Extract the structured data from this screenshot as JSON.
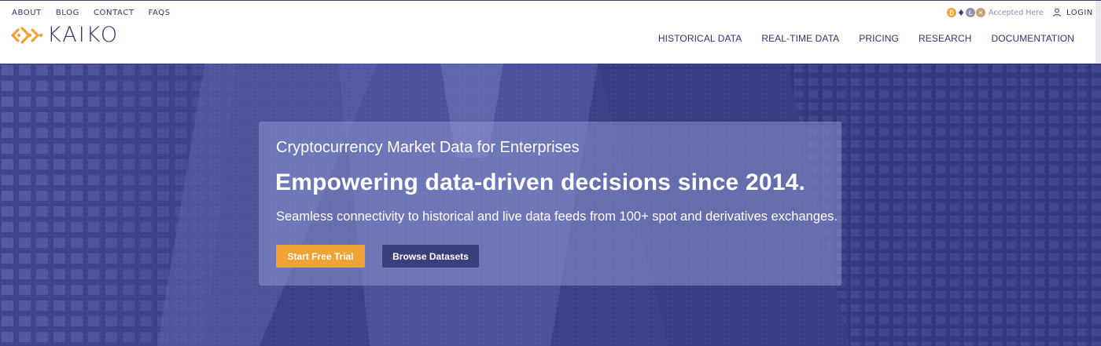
{
  "top_links": [
    "ABOUT",
    "BLOG",
    "CONTACT",
    "FAQS"
  ],
  "logo": {
    "text": "KAIKO"
  },
  "crypto": {
    "accepted_text": "Accepted Here",
    "coins": [
      "btc-icon",
      "eth-icon",
      "ltc-icon",
      "xrp-icon"
    ]
  },
  "login": {
    "label": "LOGIN"
  },
  "nav": [
    "HISTORICAL DATA",
    "REAL-TIME DATA",
    "PRICING",
    "RESEARCH",
    "DOCUMENTATION"
  ],
  "hero": {
    "kicker": "Cryptocurrency Market Data for Enterprises",
    "headline": "Empowering data-driven decisions since 2014.",
    "subtext": "Seamless connectivity to historical and live data feeds from 100+ spot and derivatives exchanges.",
    "primary_button": "Start Free Trial",
    "secondary_button": "Browse Datasets"
  },
  "colors": {
    "brand_navy": "#2f3470",
    "accent_orange": "#f0a334",
    "hero_bg": "#3b4186"
  }
}
